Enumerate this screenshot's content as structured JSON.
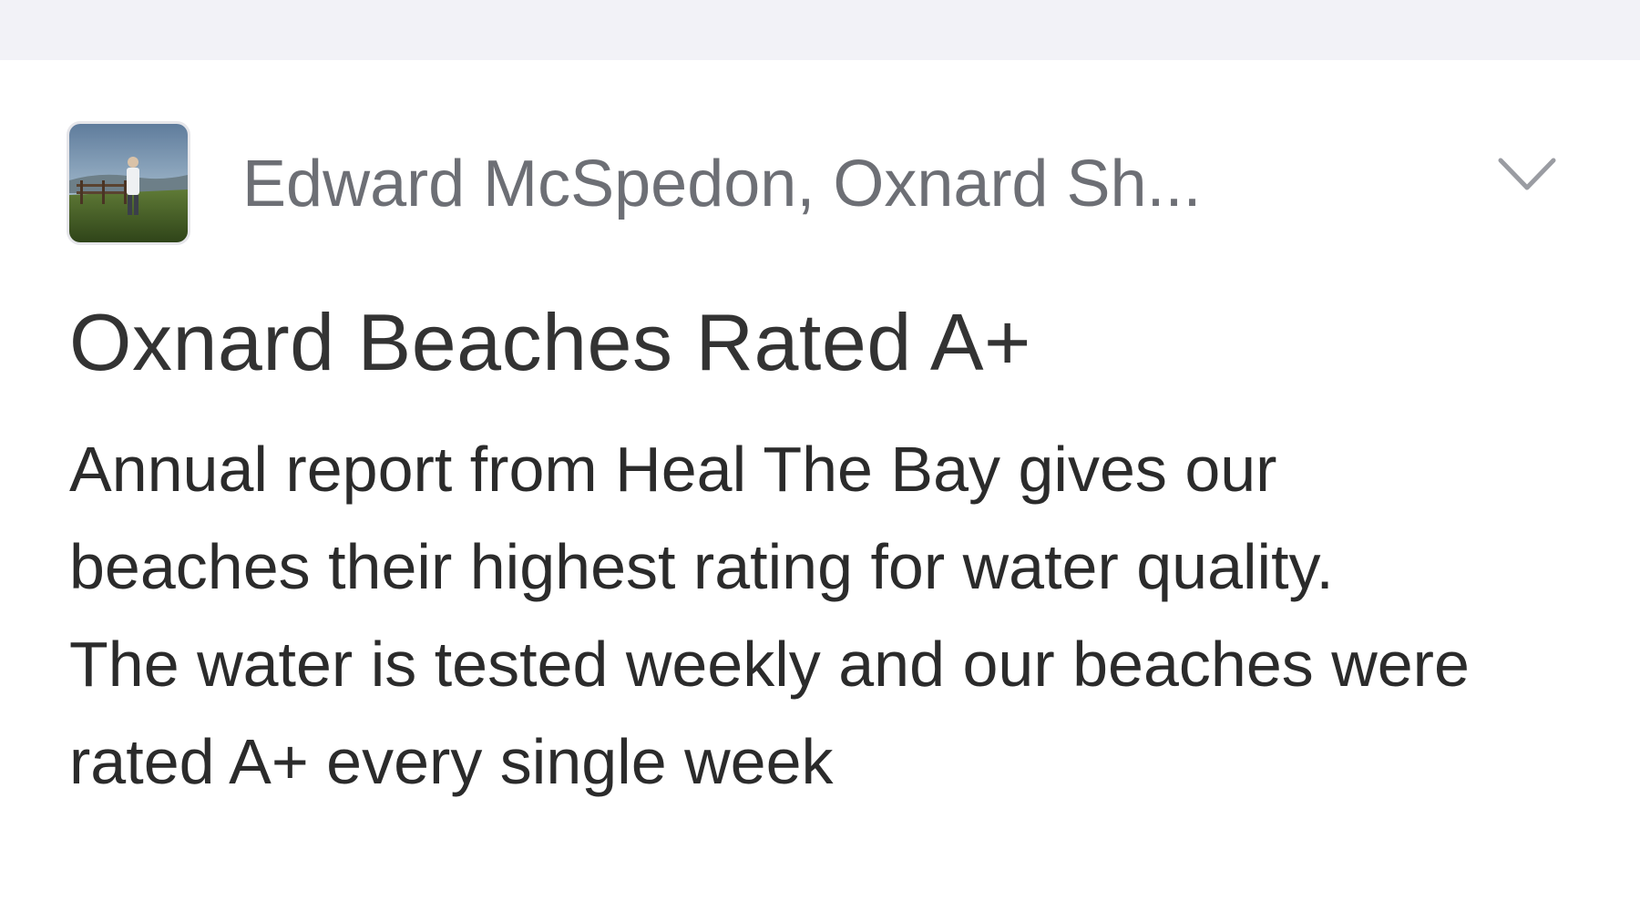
{
  "colors": {
    "top_bar": "#f2f2f7",
    "author_text": "#6d6f75",
    "title_text": "#333333",
    "body_text": "#2b2b2b",
    "chevron": "#9a9ca2"
  },
  "post": {
    "author": "Edward McSpedon, Oxnard Sh...",
    "avatar_icon": "user-photo-icon",
    "menu_icon": "chevron-down-icon",
    "title": "Oxnard Beaches Rated A+",
    "paragraphs": [
      "Annual report from Heal The Bay gives our beaches their highest rating for water quality.",
      "The water is tested weekly and our beaches were rated A+ every single week"
    ]
  }
}
